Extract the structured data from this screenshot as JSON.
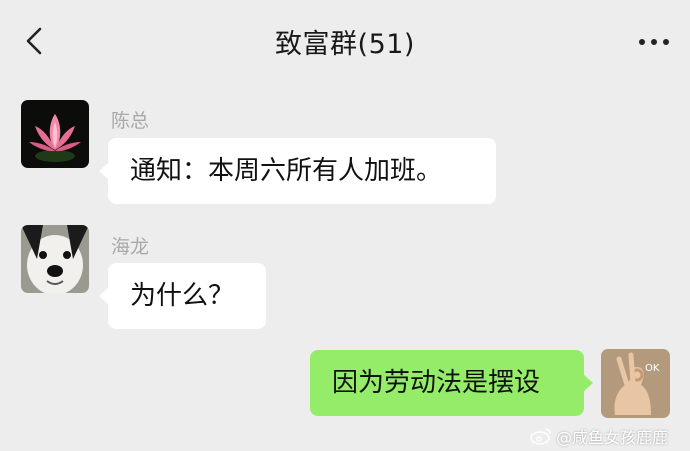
{
  "header": {
    "title": "致富群(51)",
    "back_icon": "chevron-left-icon",
    "more_icon": "more-dots-icon"
  },
  "messages": [
    {
      "sender": "陈总",
      "text": "通知：本周六所有人加班。",
      "avatar": "lotus-avatar",
      "side": "left"
    },
    {
      "sender": "海龙",
      "text": "为什么？",
      "avatar": "dog-avatar",
      "side": "left"
    },
    {
      "sender": "",
      "text": "因为劳动法是摆设",
      "avatar": "ok-hand-avatar",
      "side": "right"
    }
  ],
  "avatar_badge": "OK",
  "watermark": {
    "text": "@咸鱼女孩鹿鹿",
    "icon": "weibo-icon"
  },
  "colors": {
    "background": "#ededed",
    "incoming_bubble": "#ffffff",
    "outgoing_bubble": "#95ec69"
  }
}
